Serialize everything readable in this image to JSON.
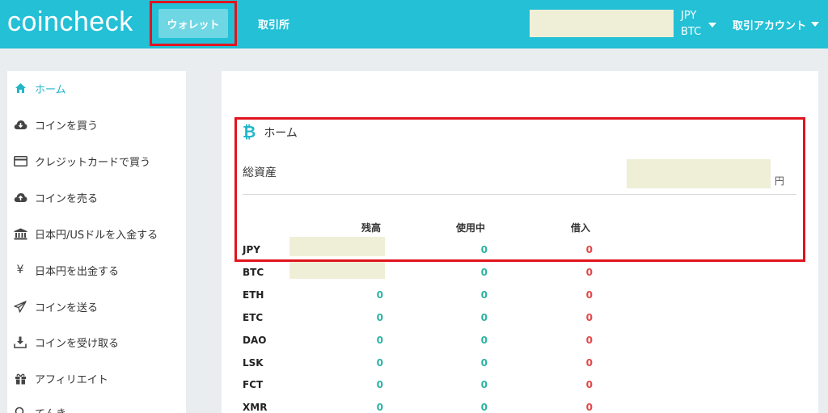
{
  "header": {
    "logo": "coincheck",
    "wallet_label": "ウォレット",
    "exchange_label": "取引所",
    "currency_top": "JPY",
    "currency_bottom": "BTC",
    "account_label": "取引アカウント"
  },
  "sidebar": {
    "items": [
      {
        "label": "ホーム",
        "icon": "home-icon",
        "active": true
      },
      {
        "label": "コインを買う",
        "icon": "cloud-download-icon"
      },
      {
        "label": "クレジットカードで買う",
        "icon": "credit-card-icon"
      },
      {
        "label": "コインを売る",
        "icon": "cloud-upload-icon"
      },
      {
        "label": "日本円/USドルを入金する",
        "icon": "bank-icon"
      },
      {
        "label": "日本円を出金する",
        "icon": "yen-icon"
      },
      {
        "label": "コインを送る",
        "icon": "send-icon"
      },
      {
        "label": "コインを受け取る",
        "icon": "download-icon"
      },
      {
        "label": "アフィリエイト",
        "icon": "gift-icon"
      },
      {
        "label": "てんき",
        "icon": "search-icon"
      }
    ],
    "accent": "#23b6c9"
  },
  "main": {
    "title": "ホーム",
    "title_icon": "bitcoin-icon",
    "total_label": "総資産",
    "yen_unit": "円",
    "columns": [
      "残高",
      "使用中",
      "借入"
    ],
    "rows": [
      {
        "currency": "JPY",
        "balance": "",
        "in_use": "0",
        "borrowed": "0"
      },
      {
        "currency": "BTC",
        "balance": "",
        "in_use": "0",
        "borrowed": "0"
      },
      {
        "currency": "ETH",
        "balance": "0",
        "in_use": "0",
        "borrowed": "0"
      },
      {
        "currency": "ETC",
        "balance": "0",
        "in_use": "0",
        "borrowed": "0"
      },
      {
        "currency": "DAO",
        "balance": "0",
        "in_use": "0",
        "borrowed": "0"
      },
      {
        "currency": "LSK",
        "balance": "0",
        "in_use": "0",
        "borrowed": "0"
      },
      {
        "currency": "FCT",
        "balance": "0",
        "in_use": "0",
        "borrowed": "0"
      },
      {
        "currency": "XMR",
        "balance": "0",
        "in_use": "0",
        "borrowed": "0"
      }
    ]
  },
  "colors": {
    "header_bg": "#23c0d6",
    "highlight": "#e0141e",
    "zero_green": "#2bb3a3",
    "zero_red": "#e24848"
  }
}
